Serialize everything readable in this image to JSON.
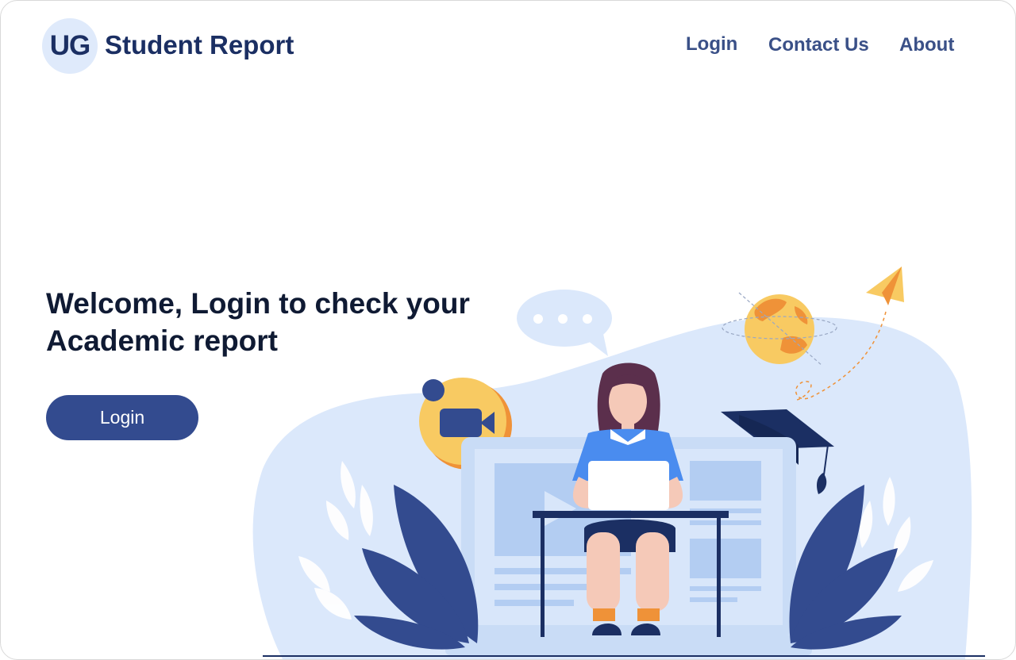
{
  "header": {
    "logo_text": "UG",
    "brand_title": "Student Report",
    "nav": [
      {
        "label": "Login"
      },
      {
        "label": "Contact Us"
      },
      {
        "label": "About"
      }
    ]
  },
  "hero": {
    "heading_line1": "Welcome, Login to check your",
    "heading_line2": "Academic report",
    "cta_label": "Login"
  },
  "colors": {
    "primary": "#334b8f",
    "brand_text": "#1b2f63",
    "nav_text": "#3a5087",
    "heading_text": "#0f1a33",
    "illustration_bg": "#dbe8fb",
    "accent_yellow": "#f8ca62",
    "accent_orange": "#ef9238",
    "shirt_blue": "#4a8cef"
  },
  "icons": [
    "video-camera-icon",
    "chat-bubble-icon",
    "globe-icon",
    "graduation-cap-icon",
    "paper-plane-icon"
  ]
}
